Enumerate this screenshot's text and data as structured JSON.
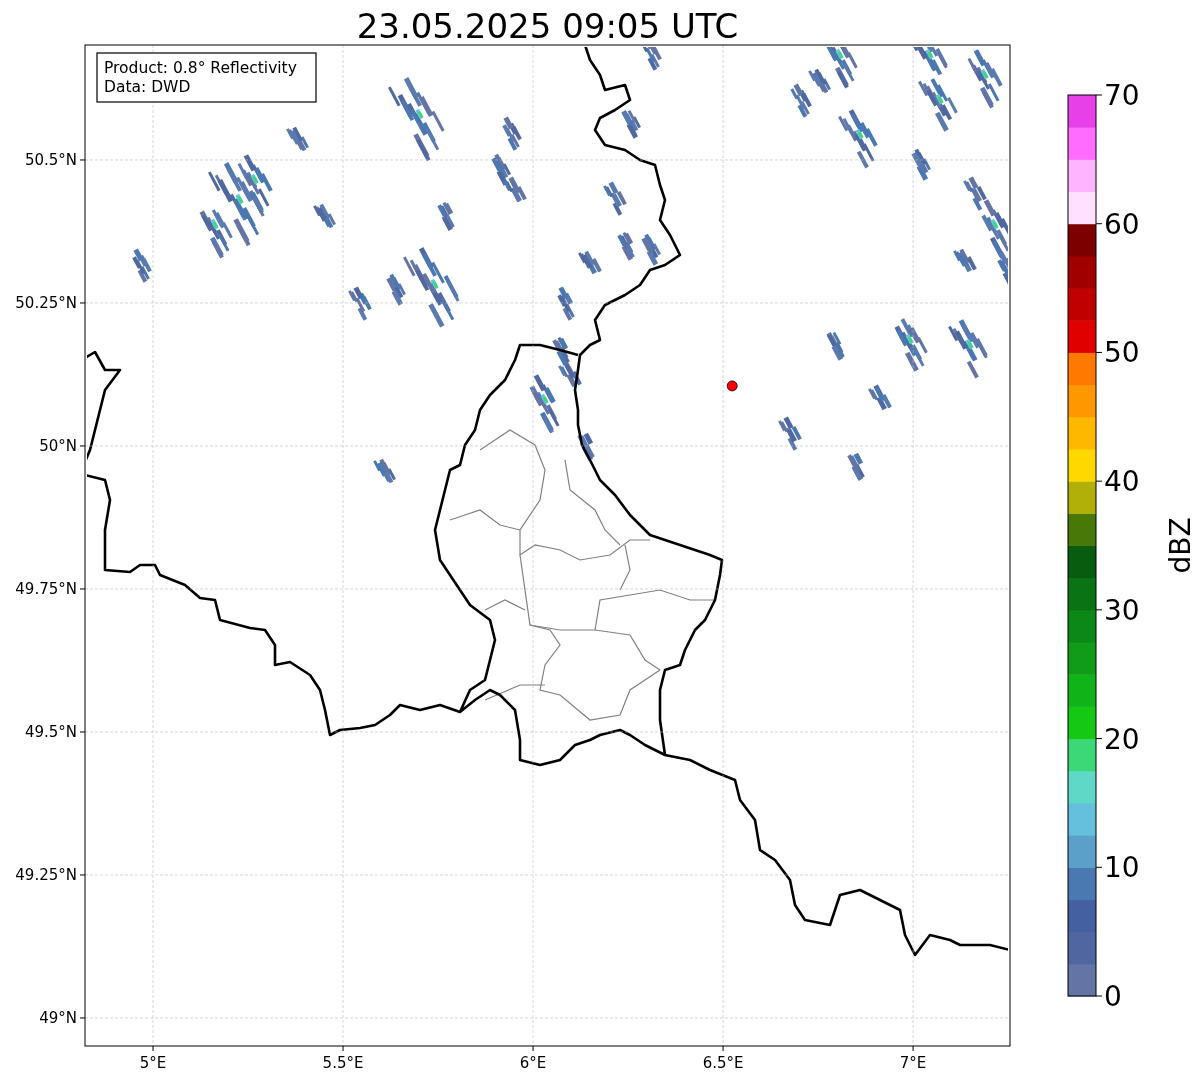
{
  "title": "23.05.2025 09:05 UTC",
  "info_box": {
    "lines": [
      "Product: 0.8° Reflectivity",
      "Data: DWD"
    ]
  },
  "map": {
    "chart_data": {
      "type": "scatter",
      "grid": true,
      "xlim": [
        4.821,
        7.255
      ],
      "ylim": [
        48.951,
        50.701
      ],
      "xticks": [
        {
          "value": 5,
          "label": "5°E"
        },
        {
          "value": 5.5,
          "label": "5.5°E"
        },
        {
          "value": 6,
          "label": "6°E"
        },
        {
          "value": 6.5,
          "label": "6.5°E"
        },
        {
          "value": 7,
          "label": "7°E"
        }
      ],
      "yticks": [
        {
          "value": 49,
          "label": "49°N"
        },
        {
          "value": 49.25,
          "label": "49.25°N"
        },
        {
          "value": 49.5,
          "label": "49.5°N"
        },
        {
          "value": 49.75,
          "label": "49.75°N"
        },
        {
          "value": 50,
          "label": "50°N"
        },
        {
          "value": 50.25,
          "label": "50.25°N"
        },
        {
          "value": 50.5,
          "label": "50.5°N"
        }
      ],
      "series": [
        {
          "color": "#ff0000",
          "x": [
            6.524
          ],
          "values": [
            50.105
          ]
        }
      ]
    }
  },
  "colorbar": {
    "label": "dBZ",
    "ticks": [
      "70",
      "60",
      "50",
      "40",
      "30",
      "20",
      "10",
      "0"
    ],
    "bins": [
      {
        "color": "#6474a4"
      },
      {
        "color": "#5066a0"
      },
      {
        "color": "#4460a0"
      },
      {
        "color": "#4a78b0"
      },
      {
        "color": "#5aa0c8"
      },
      {
        "color": "#64c0dc"
      },
      {
        "color": "#60d8c8"
      },
      {
        "color": "#3cd878"
      },
      {
        "color": "#14c814"
      },
      {
        "color": "#10b418"
      },
      {
        "color": "#109c18"
      },
      {
        "color": "#0c8818"
      },
      {
        "color": "#0a7414"
      },
      {
        "color": "#085c10"
      },
      {
        "color": "#487808"
      },
      {
        "color": "#b0b008"
      },
      {
        "color": "#ffd800"
      },
      {
        "color": "#ffb800"
      },
      {
        "color": "#ff9800"
      },
      {
        "color": "#ff7800"
      },
      {
        "color": "#e00000"
      },
      {
        "color": "#c00000"
      },
      {
        "color": "#a00000"
      },
      {
        "color": "#7c0000"
      },
      {
        "color": "#ffe0ff"
      },
      {
        "color": "#ffb4ff"
      },
      {
        "color": "#ff6cff"
      },
      {
        "color": "#e840e8"
      }
    ]
  }
}
